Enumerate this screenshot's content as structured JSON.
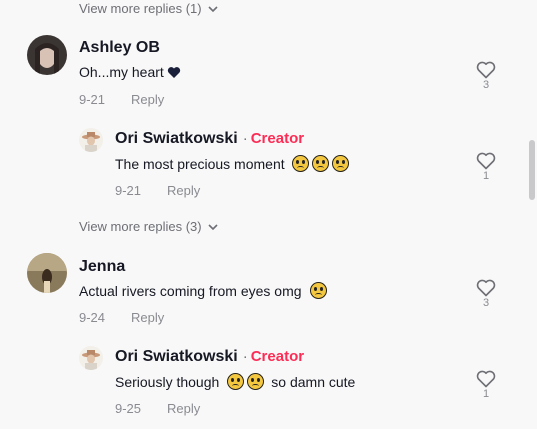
{
  "view_more_1": "View more replies (1)",
  "view_more_2": "View more replies (3)",
  "comments": [
    {
      "author": "Ashley OB",
      "text": "Oh...my heart",
      "date": "9-21",
      "reply_label": "Reply",
      "likes": "3",
      "reply": {
        "author": "Ori Swiatkowski",
        "dot": "·",
        "badge": "Creator",
        "text": "The most precious moment",
        "date": "9-21",
        "reply_label": "Reply",
        "likes": "1"
      }
    },
    {
      "author": "Jenna",
      "text": "Actual rivers coming from eyes omg",
      "date": "9-24",
      "reply_label": "Reply",
      "likes": "3",
      "reply": {
        "author": "Ori Swiatkowski",
        "dot": "·",
        "badge": "Creator",
        "text_before": "Seriously though",
        "text_after": "so damn cute",
        "date": "9-25",
        "reply_label": "Reply",
        "likes": "1"
      }
    }
  ],
  "colors": {
    "creator": "#fe2c55",
    "muted": "#8a8b91",
    "text": "#161823",
    "background": "#f8f8f8"
  },
  "icons": {
    "heart": "heart-outline-icon",
    "chevron": "chevron-down-icon",
    "black_heart": "black-heart-emoji",
    "sad_face": "sad-face-emoji"
  }
}
